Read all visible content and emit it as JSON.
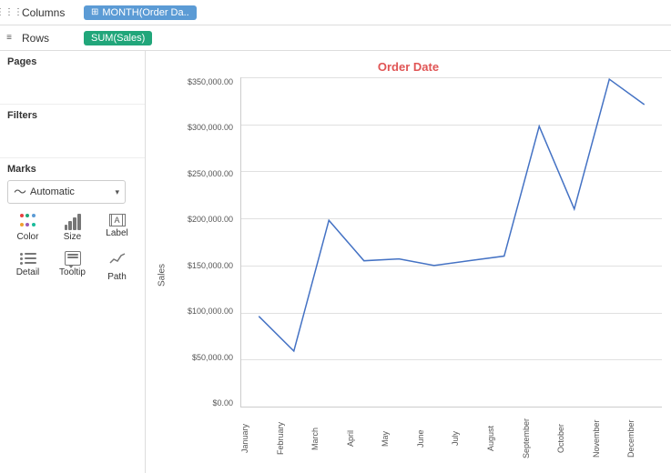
{
  "shelves": {
    "columns_icon": "⋮⋮⋮",
    "columns_label": "Columns",
    "columns_pill": "MONTH(Order Da..",
    "rows_icon": "≡≡",
    "rows_label": "Rows",
    "rows_pill": "SUM(Sales)"
  },
  "left_panel": {
    "pages_title": "Pages",
    "filters_title": "Filters",
    "marks_title": "Marks",
    "marks_dropdown": "Automatic",
    "marks_items": [
      {
        "id": "color",
        "label": "Color"
      },
      {
        "id": "size",
        "label": "Size"
      },
      {
        "id": "label",
        "label": "Label"
      },
      {
        "id": "detail",
        "label": "Detail"
      },
      {
        "id": "tooltip",
        "label": "Tooltip"
      },
      {
        "id": "path",
        "label": "Path"
      }
    ]
  },
  "chart": {
    "title": "Order Date",
    "y_axis_label": "Sales",
    "y_ticks": [
      "$350,000.00",
      "$300,000.00",
      "$250,000.00",
      "$200,000.00",
      "$150,000.00",
      "$100,000.00",
      "$50,000.00",
      "$0.00"
    ],
    "x_ticks": [
      "January",
      "February",
      "March",
      "April",
      "May",
      "June",
      "July",
      "August",
      "September",
      "October",
      "November",
      "December"
    ],
    "line_color": "#4472c4",
    "data_points": [
      {
        "month": "January",
        "value": 96000
      },
      {
        "month": "February",
        "value": 59000
      },
      {
        "month": "March",
        "value": 198000
      },
      {
        "month": "April",
        "value": 155000
      },
      {
        "month": "May",
        "value": 157000
      },
      {
        "month": "June",
        "value": 150000
      },
      {
        "month": "July",
        "value": 155000
      },
      {
        "month": "August",
        "value": 160000
      },
      {
        "month": "September",
        "value": 298000
      },
      {
        "month": "October",
        "value": 210000
      },
      {
        "month": "November",
        "value": 348000
      },
      {
        "month": "December",
        "value": 321000
      }
    ]
  },
  "colors": {
    "accent_red": "#e05555",
    "pill_blue": "#5b9bd5",
    "pill_green": "#21a67a",
    "line_blue": "#4472c4"
  }
}
